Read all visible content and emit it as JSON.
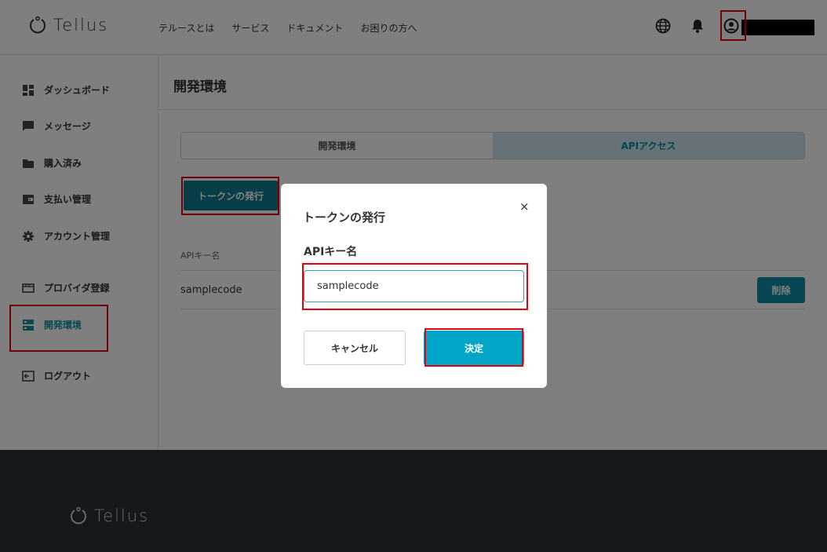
{
  "header": {
    "logo_text": "Tellus",
    "nav": [
      "テルースとは",
      "サービス",
      "ドキュメント",
      "お困りの方へ"
    ]
  },
  "sidebar": {
    "items": [
      {
        "label": "ダッシュボード",
        "icon": "dashboard-icon"
      },
      {
        "label": "メッセージ",
        "icon": "message-icon"
      },
      {
        "label": "購入済み",
        "icon": "folder-icon"
      },
      {
        "label": "支払い管理",
        "icon": "wallet-icon"
      },
      {
        "label": "アカウント管理",
        "icon": "gear-icon"
      },
      {
        "label": "プロバイダ登録",
        "icon": "provider-icon"
      },
      {
        "label": "開発環境",
        "icon": "server-icon",
        "active": true
      },
      {
        "label": "ログアウト",
        "icon": "logout-icon"
      }
    ]
  },
  "main": {
    "title": "開発環境",
    "tabs": [
      {
        "label": "開発環境",
        "active": false
      },
      {
        "label": "APIアクセス",
        "active": true
      }
    ],
    "issue_button": "トークンの発行",
    "column_header": "APIキー名",
    "rows": [
      {
        "name": "samplecode",
        "delete_label": "削除"
      }
    ]
  },
  "footer": {
    "logo_text": "Tellus"
  },
  "modal": {
    "title": "トークンの発行",
    "close_symbol": "×",
    "field_label": "APIキー名",
    "field_value": "samplecode",
    "cancel_label": "キャンセル",
    "ok_label": "決定"
  },
  "colors": {
    "accent": "#0e7d90",
    "primary_button": "#00a5c8",
    "active_tab_bg": "#cde7ec",
    "highlight_border": "#e60012",
    "footer_bg": "#2d3338"
  }
}
